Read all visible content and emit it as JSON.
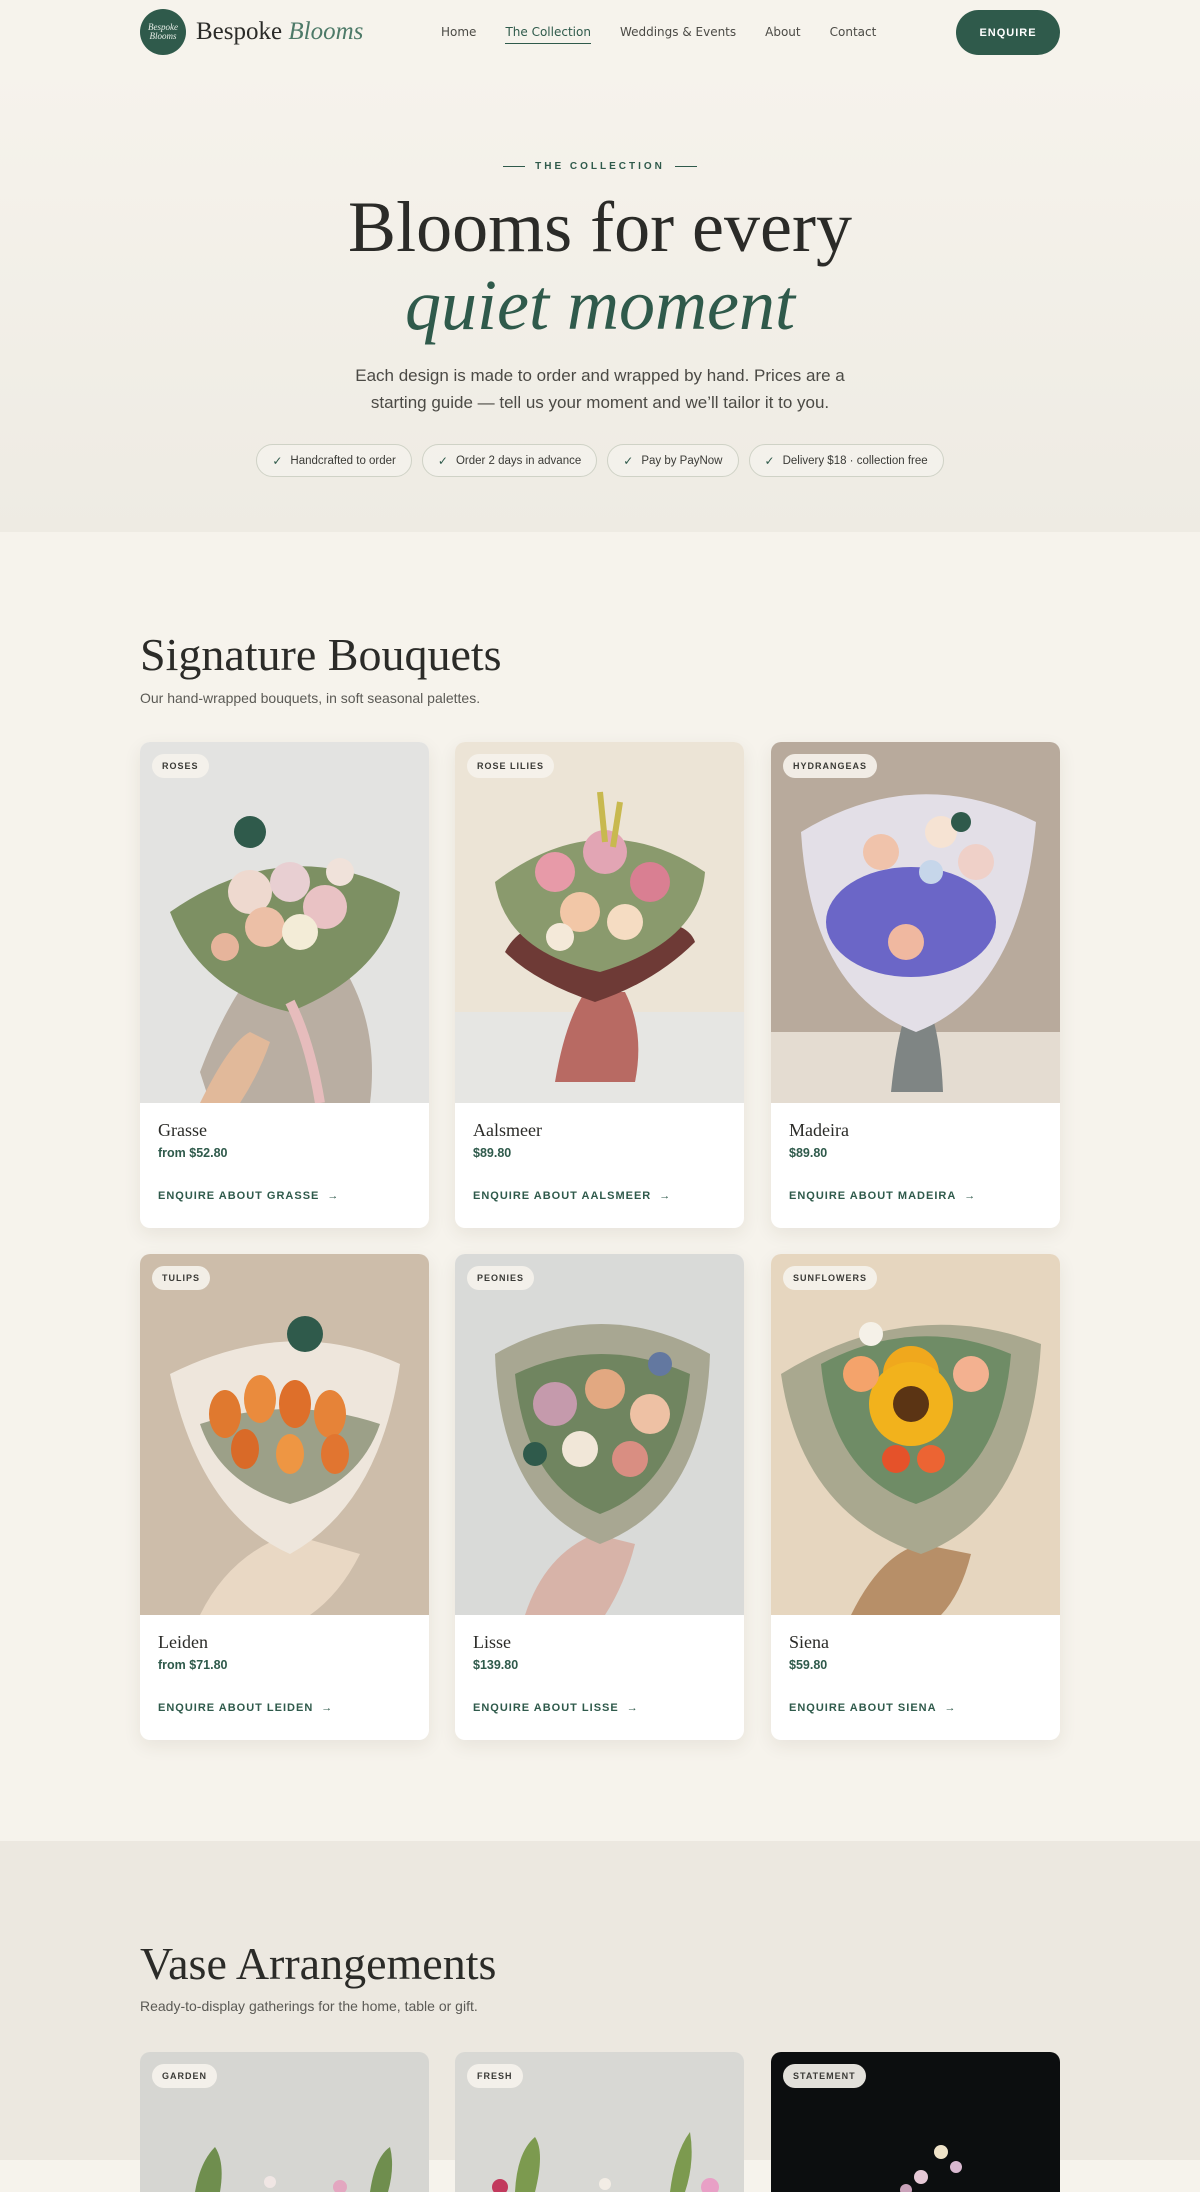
{
  "brand": {
    "name": "Bespoke",
    "name_accent": "Blooms",
    "mark_line1": "Bespoke",
    "mark_line2": "Blooms"
  },
  "nav": {
    "items": [
      "Home",
      "The Collection",
      "Weddings & Events",
      "About",
      "Contact"
    ],
    "active": "The Collection",
    "cta": "ENQUIRE"
  },
  "hero": {
    "eyebrow": "THE COLLECTION",
    "title_line1": "Blooms for every",
    "title_line2": "quiet moment",
    "description": "Each design is made to order and wrapped by hand. Prices are a starting guide — tell us your moment and we’ll tailor it to you.",
    "pills": [
      "Handcrafted to order",
      "Order 2 days in advance",
      "Pay by PayNow",
      "Delivery $18 · collection free"
    ]
  },
  "signature": {
    "title": "Signature Bouquets",
    "subtitle": "Our hand-wrapped bouquets, in soft seasonal palettes.",
    "cards": [
      {
        "tag": "ROSES",
        "name": "Grasse",
        "price": "from $52.80",
        "link": "ENQUIRE ABOUT GRASSE"
      },
      {
        "tag": "ROSE LILIES",
        "name": "Aalsmeer",
        "price": "$89.80",
        "link": "ENQUIRE ABOUT AALSMEER"
      },
      {
        "tag": "HYDRANGEAS",
        "name": "Madeira",
        "price": "$89.80",
        "link": "ENQUIRE ABOUT MADEIRA"
      },
      {
        "tag": "TULIPS",
        "name": "Leiden",
        "price": "from $71.80",
        "link": "ENQUIRE ABOUT LEIDEN"
      },
      {
        "tag": "PEONIES",
        "name": "Lisse",
        "price": "$139.80",
        "link": "ENQUIRE ABOUT LISSE"
      },
      {
        "tag": "SUNFLOWERS",
        "name": "Siena",
        "price": "$59.80",
        "link": "ENQUIRE ABOUT SIENA"
      }
    ]
  },
  "vase": {
    "title": "Vase Arrangements",
    "subtitle": "Ready-to-display gatherings for the home, table or gift.",
    "tags": [
      "GARDEN",
      "FRESH",
      "STATEMENT"
    ]
  },
  "icons": {
    "check": "check-icon",
    "arrow": "arrow-right-icon"
  }
}
